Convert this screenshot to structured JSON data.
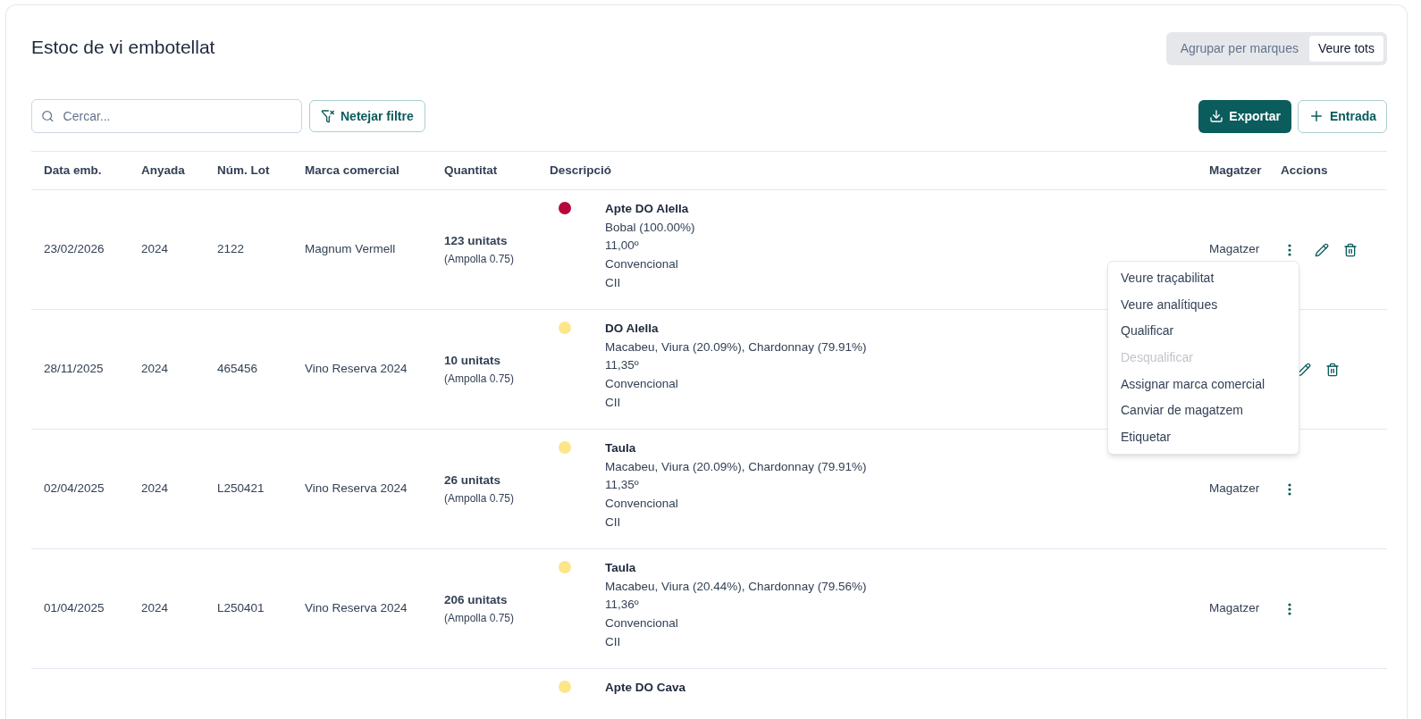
{
  "title": "Estoc de vi embotellat",
  "view_toggle": [
    {
      "label": "Agrupar per marques",
      "selected": false
    },
    {
      "label": "Veure tots",
      "selected": true
    }
  ],
  "search": {
    "placeholder": "Cercar..."
  },
  "clear_filter": "Netejar filtre",
  "export_button": "Exportar",
  "add_button": "Entrada",
  "columns": [
    "Data emb.",
    "Anyada",
    "Núm. Lot",
    "Marca comercial",
    "Quantitat",
    "Descripció",
    "Magatzer",
    "Accions"
  ],
  "rows": [
    {
      "date": "23/02/2026",
      "year": "2024",
      "lot": "2122",
      "brand": "Magnum Vermell",
      "quantity": "123 unitats",
      "format": "(Ampolla 0.75)",
      "color": "#b5073a",
      "desc_title": "Apte DO Alella",
      "desc_lines": [
        "Bobal (100.00%)",
        "11,00º",
        "Convencional",
        "CII"
      ],
      "warehouse": "Magatzer",
      "menu_button": true,
      "editable": true
    },
    {
      "date": "28/11/2025",
      "year": "2024",
      "lot": "465456",
      "brand": "Vino Reserva 2024",
      "quantity": "10 unitats",
      "format": "(Ampolla 0.75)",
      "color": "#fde68a",
      "desc_title": "DO Alella",
      "desc_lines": [
        "Macabeu, Viura (20.09%), Chardonnay (79.91%)",
        "11,35º",
        "Convencional",
        "CII"
      ],
      "menu_button": false,
      "editable": true
    },
    {
      "date": "02/04/2025",
      "year": "2024",
      "lot": "L250421",
      "brand": "Vino Reserva 2024",
      "quantity": "26 unitats",
      "format": "(Ampolla 0.75)",
      "color": "#fde68a",
      "desc_title": "Taula",
      "desc_lines": [
        "Macabeu, Viura (20.09%), Chardonnay (79.91%)",
        "11,35º",
        "Convencional",
        "CII"
      ],
      "warehouse": "Magatzer",
      "menu_button": true,
      "editable": false
    },
    {
      "date": "01/04/2025",
      "year": "2024",
      "lot": "L250401",
      "brand": "Vino Reserva 2024",
      "quantity": "206 unitats",
      "format": "(Ampolla 0.75)",
      "color": "#fde68a",
      "desc_title": "Taula",
      "desc_lines": [
        "Macabeu, Viura (20.44%), Chardonnay (79.56%)",
        "11,36º",
        "Convencional",
        "CII"
      ],
      "warehouse": "Magatzer",
      "menu_button": true,
      "editable": false
    },
    {
      "color": "#fde68a",
      "desc_title": "Apte DO Cava",
      "desc_lines": []
    }
  ],
  "menu": [
    {
      "label": "Veure traçabilitat",
      "disabled": false
    },
    {
      "label": "Veure analítiques",
      "disabled": false
    },
    {
      "label": "Qualificar",
      "disabled": false
    },
    {
      "label": "Desqualificar",
      "disabled": true
    },
    {
      "label": "Assignar marca comercial",
      "disabled": false
    },
    {
      "label": "Canviar de magatzem",
      "disabled": false
    },
    {
      "label": "Etiquetar",
      "disabled": false
    }
  ]
}
